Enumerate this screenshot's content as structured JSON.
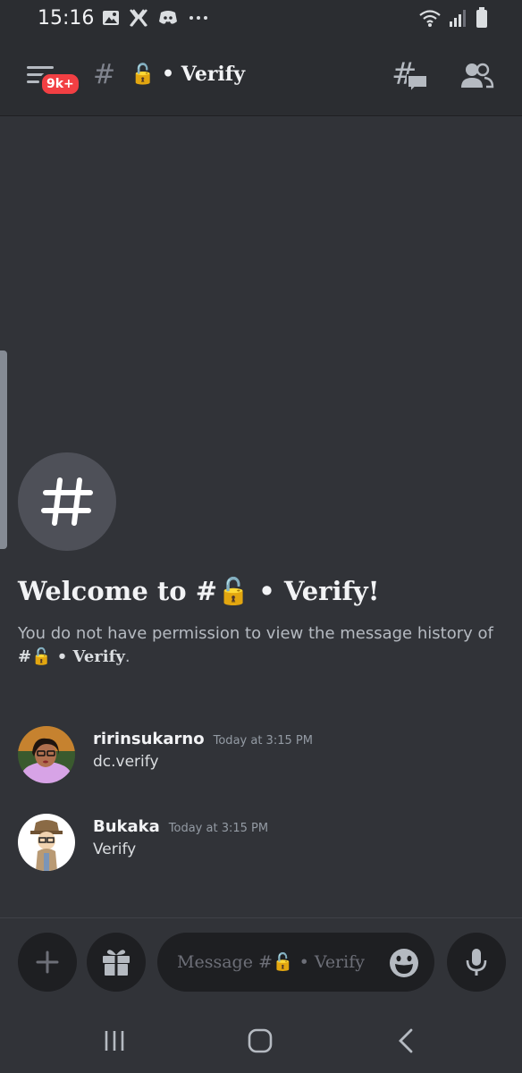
{
  "status_bar": {
    "time": "15:16"
  },
  "header": {
    "badge": "9k+",
    "hash": "#",
    "channel_name": "🔓 • Verify"
  },
  "welcome": {
    "title": "Welcome to #🔓 • Verify!",
    "desc_text": "You do not have permission to view the message history of",
    "desc_channel": "#🔓 • Verify",
    "desc_end": "."
  },
  "messages": [
    {
      "author": "ririnsukarno",
      "time": "Today at 3:15 PM",
      "content": "dc.verify"
    },
    {
      "author": "Bukaka",
      "time": "Today at 3:15 PM",
      "content": "Verify"
    }
  ],
  "composer": {
    "placeholder": "Message #🔓 • Verify"
  },
  "colors": {
    "background": "#313338",
    "header": "#2b2d31",
    "badge": "#f23f43",
    "input": "#1e1f22"
  }
}
